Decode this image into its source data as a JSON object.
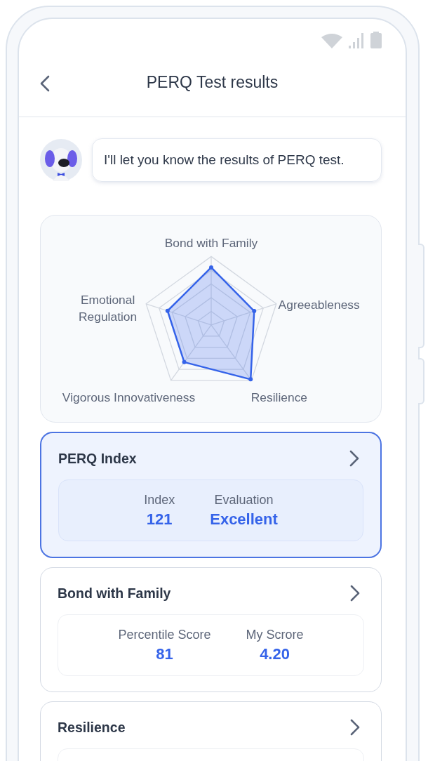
{
  "header": {
    "title": "PERQ Test results"
  },
  "message": {
    "text": "I'll let you know the results of PERQ test."
  },
  "radar": {
    "axes": [
      {
        "label": "Bond with Family"
      },
      {
        "label": "Emotional Regulation"
      },
      {
        "label": "Agreeableness"
      },
      {
        "label": "Vigorous Innovativeness"
      },
      {
        "label": "Resilience"
      }
    ]
  },
  "cards": [
    {
      "title": "PERQ Index",
      "selected": true,
      "stats": [
        {
          "label": "Index",
          "value": "121"
        },
        {
          "label": "Evaluation",
          "value": "Excellent"
        }
      ]
    },
    {
      "title": "Bond with Family",
      "selected": false,
      "stats": [
        {
          "label": "Percentile Score",
          "value": "81"
        },
        {
          "label": "My Scrore",
          "value": "4.20"
        }
      ]
    },
    {
      "title": "Resilience",
      "selected": false
    }
  ]
}
